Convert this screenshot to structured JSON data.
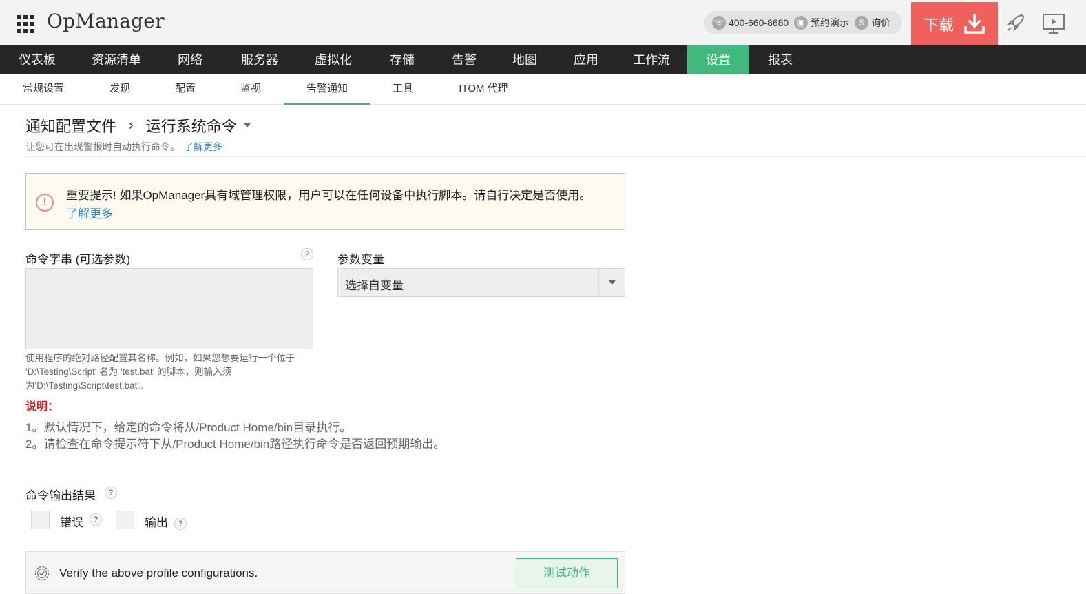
{
  "header": {
    "brand": "OpManager",
    "phone": "400-660-8680",
    "demo_label": "预约演示",
    "price_label": "询价",
    "download_label": "下载"
  },
  "main_nav": [
    {
      "label": "仪表板",
      "active": false
    },
    {
      "label": "资源清单",
      "active": false
    },
    {
      "label": "网络",
      "active": false
    },
    {
      "label": "服务器",
      "active": false
    },
    {
      "label": "虚拟化",
      "active": false
    },
    {
      "label": "存储",
      "active": false
    },
    {
      "label": "告警",
      "active": false
    },
    {
      "label": "地图",
      "active": false
    },
    {
      "label": "应用",
      "active": false
    },
    {
      "label": "工作流",
      "active": false
    },
    {
      "label": "设置",
      "active": true
    },
    {
      "label": "报表",
      "active": false
    }
  ],
  "sub_nav": [
    {
      "label": "常规设置",
      "active": false
    },
    {
      "label": "发现",
      "active": false
    },
    {
      "label": "配置",
      "active": false
    },
    {
      "label": "监视",
      "active": false
    },
    {
      "label": "告警通知",
      "active": true
    },
    {
      "label": "工具",
      "active": false
    },
    {
      "label": "ITOM 代理",
      "active": false
    }
  ],
  "page": {
    "breadcrumb_parent": "通知配置文件",
    "breadcrumb_sep": "›",
    "breadcrumb_current": "运行系统命令",
    "description": "让您可在出现警报时自动执行命令。",
    "learn_more": "了解更多"
  },
  "alert": {
    "icon_text": "!",
    "text": "重要提示! 如果OpManager具有域管理权限，用户可以在任何设备中执行脚本。请自行决定是否使用。",
    "link": "了解更多"
  },
  "form": {
    "command_label": "命令字串 (可选参数)",
    "command_value": "",
    "variables_label": "参数变量",
    "variables_selected": "选择自变量",
    "hint": "使用程序的绝对路径配置其名称。例如，如果您想要运行一个位于 'D:\\Testing\\Script' 名为 'test.bat' 的脚本，则输入须为'D:\\Testing\\Script\\test.bat'。",
    "note_title": "说明：",
    "note_lines": [
      "1。默认情况下，给定的命令将从/Product Home/bin目录执行。",
      "2。请检查在命令提示符下从/Product Home/bin路径执行命令是否返回预期输出。"
    ],
    "output_label": "命令输出结果",
    "error_label": "错误",
    "output_option_label": "输出",
    "error_checked": false,
    "output_checked": false,
    "help_symbol": "?"
  },
  "verify": {
    "text": "Verify the above profile configurations.",
    "button": "测试动作"
  },
  "colors": {
    "accent_green": "#41b97a",
    "download_red": "#f0605c",
    "nav_dark": "#262626",
    "link_blue": "#2a8bd0",
    "note_red": "#d12222"
  }
}
